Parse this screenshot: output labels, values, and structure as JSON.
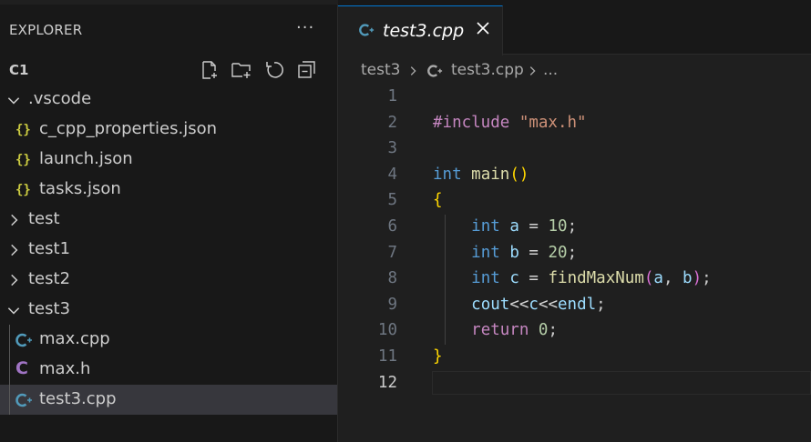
{
  "explorer": {
    "header": "EXPLORER",
    "more_label": "···",
    "root_folder": "C1",
    "items": [
      {
        "label": ".vscode",
        "kind": "folder-open"
      },
      {
        "label": "c_cpp_properties.json",
        "kind": "json",
        "icon_text": "{}"
      },
      {
        "label": "launch.json",
        "kind": "json",
        "icon_text": "{}"
      },
      {
        "label": "tasks.json",
        "kind": "json",
        "icon_text": "{}"
      },
      {
        "label": "test",
        "kind": "folder-closed"
      },
      {
        "label": "test1",
        "kind": "folder-closed"
      },
      {
        "label": "test2",
        "kind": "folder-closed"
      },
      {
        "label": "test3",
        "kind": "folder-open"
      },
      {
        "label": "max.cpp",
        "kind": "cpp"
      },
      {
        "label": "max.h",
        "kind": "c-header",
        "icon_text": "C"
      },
      {
        "label": "test3.cpp",
        "kind": "cpp",
        "selected": true
      }
    ]
  },
  "tab": {
    "title": "test3.cpp",
    "close_label": "close"
  },
  "breadcrumb": {
    "folder": "test3",
    "file": "test3.cpp",
    "ellipsis": "..."
  },
  "code": {
    "line_numbers": [
      "1",
      "2",
      "3",
      "4",
      "5",
      "6",
      "7",
      "8",
      "9",
      "10",
      "11",
      "12"
    ],
    "active_line": "12",
    "lines": [
      "",
      "#include \"max.h\"",
      "",
      "int main()",
      "{",
      "    int a = 10;",
      "    int b = 20;",
      "    int c = findMaxNum(a, b);",
      "    cout<<c<<endl;",
      "    return 0;",
      "}",
      ""
    ]
  },
  "colors": {
    "accent": "#0078d4",
    "json_icon": "#cbcb41",
    "cpp_icon": "#519aba",
    "c_icon": "#a074c4",
    "selection": "#37373d"
  },
  "icons": {
    "new_file": "new-file-icon",
    "new_folder": "new-folder-icon",
    "refresh": "refresh-icon",
    "collapse": "collapse-all-icon"
  }
}
